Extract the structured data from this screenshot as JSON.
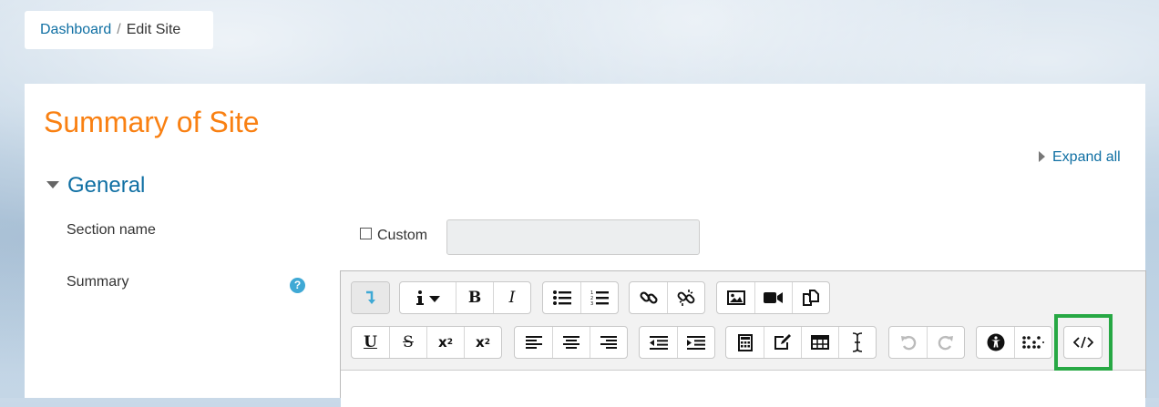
{
  "breadcrumb": {
    "home": "Dashboard",
    "separator": "/",
    "current": "Edit Site"
  },
  "page": {
    "title": "Summary of Site",
    "expand_all": "Expand all"
  },
  "section": {
    "title": "General",
    "section_name_label": "Section name",
    "custom_label": "Custom",
    "summary_label": "Summary",
    "help_glyph": "?"
  },
  "toolbar": {
    "row1": [
      [
        "collapse-toggle"
      ],
      [
        "style-info",
        "bold",
        "italic"
      ],
      [
        "unordered-list",
        "ordered-list"
      ],
      [
        "link",
        "unlink"
      ],
      [
        "image",
        "media",
        "manage-files"
      ]
    ],
    "row2": [
      [
        "underline",
        "strikethrough",
        "subscript",
        "superscript"
      ],
      [
        "align-left",
        "align-center",
        "align-right"
      ],
      [
        "outdent",
        "indent"
      ],
      [
        "equation",
        "special-characters",
        "table",
        "clear-formatting"
      ],
      [
        "undo",
        "redo"
      ],
      [
        "accessibility-checker",
        "screenreader-helper"
      ],
      [
        "html-source"
      ]
    ],
    "highlighted_button": "html-source"
  },
  "colors": {
    "accent": "#f98012",
    "link": "#0f6fa3",
    "highlight": "#27a844"
  }
}
